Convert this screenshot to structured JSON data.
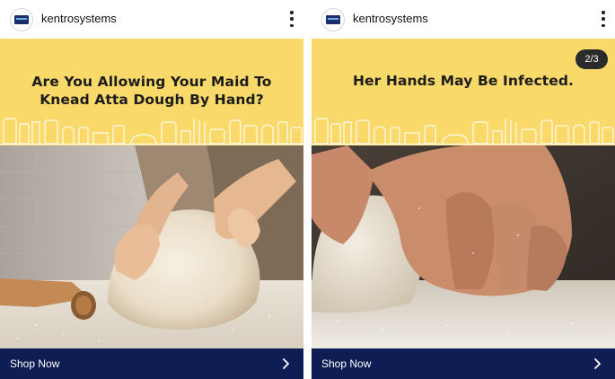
{
  "posts": [
    {
      "username": "kentrosystems",
      "headline_line1": "Are You Allowing Your Maid To",
      "headline_line2": "Knead Atta Dough By Hand?",
      "cta_label": "Shop Now"
    },
    {
      "username": "kentrosystems",
      "headline_line1": "Her Hands May Be Infected.",
      "slide_counter": "2/3",
      "cta_label": "Shop Now"
    }
  ],
  "colors": {
    "banner_yellow": "#f8d96a",
    "cta_navy": "#0f1d55",
    "text_dark": "#1c1c1c"
  },
  "icons": {
    "menu": "more-vertical-icon",
    "cta_arrow": "chevron-right-icon",
    "avatar": "kent-logo"
  }
}
